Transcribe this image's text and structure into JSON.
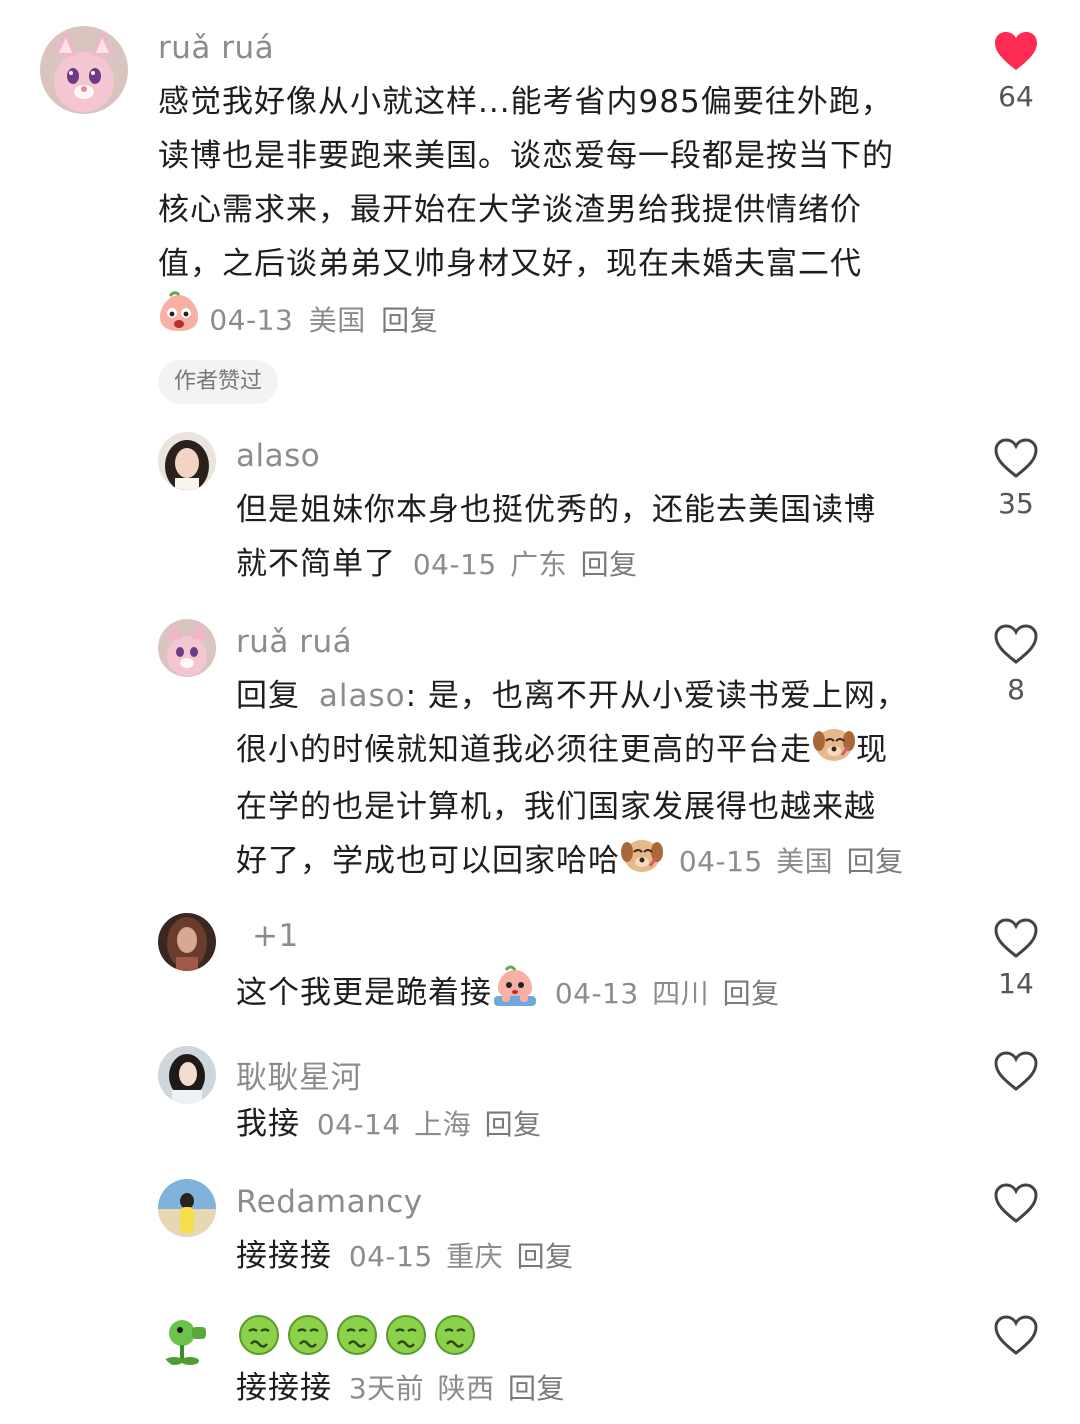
{
  "comments": [
    {
      "username": "ruǎ ruá",
      "lines": [
        "感觉我好像从小就这样...能考省内985偏要往外跑，",
        "读博也是非要跑来美国。谈恋爱每一段都是按当下的",
        "核心需求来，最开始在大学谈渣男给我提供情绪价",
        "值，之后谈弟弟又帅身材又好，现在未婚夫富二代"
      ],
      "emoji": "surprised-peach-emoji",
      "date": "04-13",
      "location": "美国",
      "reply": "回复",
      "likes": "64",
      "liked": true,
      "badge": "作者赞过"
    },
    {
      "username": "alaso",
      "line1": "但是姐妹你本身也挺优秀的，还能去美国读博",
      "line2": "就不简单了",
      "date": "04-15",
      "location": "广东",
      "reply": "回复",
      "likes": "35"
    },
    {
      "username": "ruǎ ruá",
      "reply_prefix": "回复",
      "mention": "alaso",
      "colon_text": ": 是，也离不开从小爱读书爱上网，",
      "line2": "很小的时候就知道我必须往更高的平台走",
      "line2_tail": "现",
      "line3": "在学的也是计算机，我们国家发展得也越来越",
      "line4": "好了，学成也可以回家哈哈",
      "emoji": "dog-emoji",
      "date": "04-15",
      "location": "美国",
      "reply": "回复",
      "likes": "8"
    },
    {
      "username": "+1",
      "text": "这个我更是跪着接",
      "emoji": "kneeling-peach-emoji",
      "date": "04-13",
      "location": "四川",
      "reply": "回复",
      "likes": "14"
    },
    {
      "username": "耿耿星河",
      "text": "我接",
      "date": "04-14",
      "location": "上海",
      "reply": "回复",
      "likes": ""
    },
    {
      "username": "Redamancy",
      "text": "接接接",
      "date": "04-15",
      "location": "重庆",
      "reply": "回复",
      "likes": ""
    },
    {
      "username_emojis": [
        "sick-face-emoji",
        "sick-face-emoji",
        "sick-face-emoji",
        "sick-face-emoji",
        "sick-face-emoji"
      ],
      "text": "接接接",
      "date": "3天前",
      "location": "陕西",
      "reply": "回复",
      "likes": ""
    }
  ],
  "colors": {
    "like_red": "#fe2c55",
    "muted": "#8c8c8c"
  }
}
